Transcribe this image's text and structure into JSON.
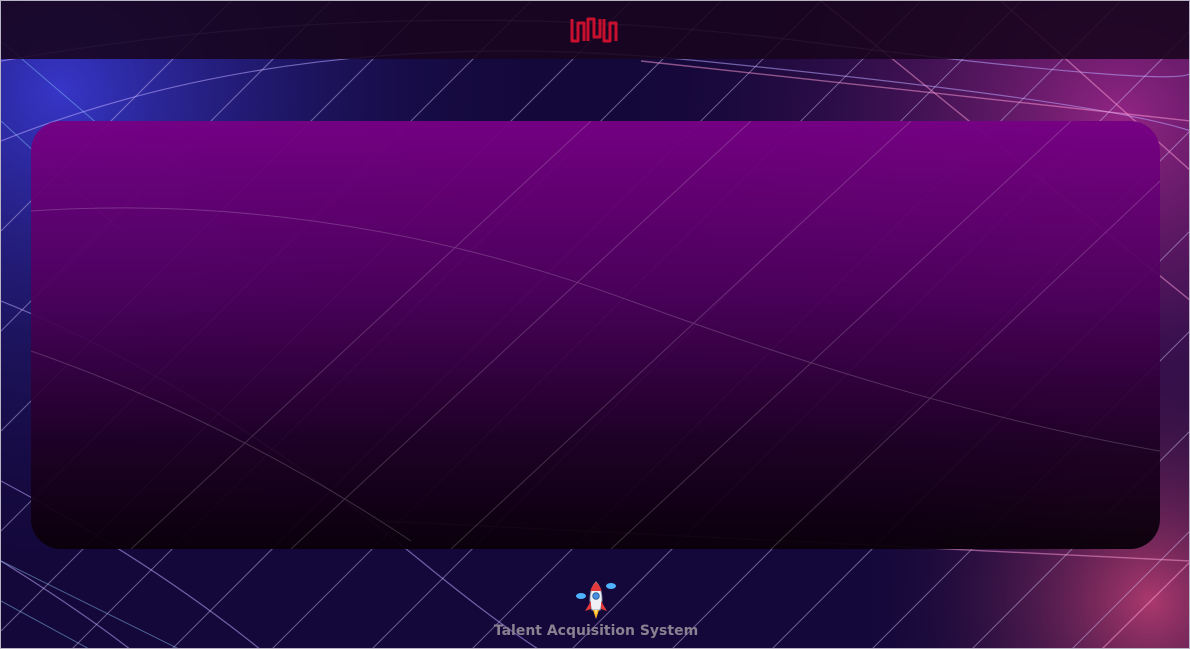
{
  "app": {
    "logo_name": "company-logo",
    "logo_color": "#c8102e"
  },
  "panel": {
    "gradient_top": "#760084",
    "gradient_bottom": "#0a000a"
  },
  "footer": {
    "icon": "rocket-icon",
    "title": "Talent Acquisition System"
  }
}
